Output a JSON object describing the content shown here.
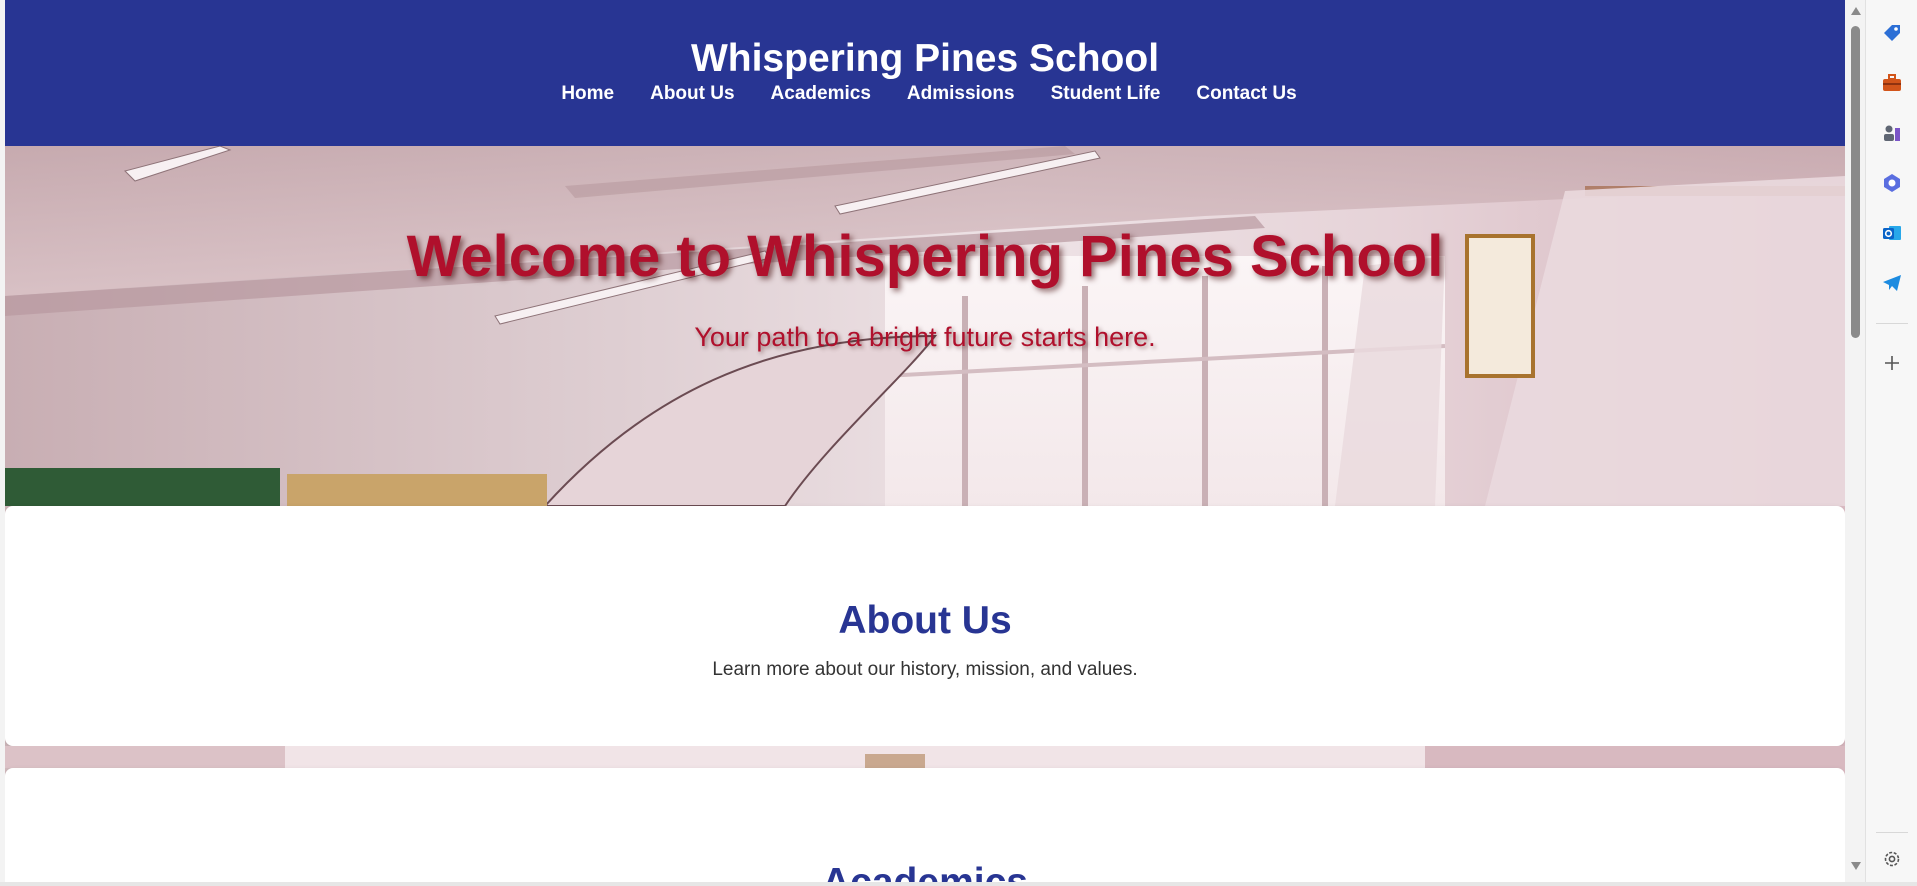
{
  "header": {
    "title": "Whispering Pines School",
    "nav": [
      {
        "label": "Home"
      },
      {
        "label": "About Us"
      },
      {
        "label": "Academics"
      },
      {
        "label": "Admissions"
      },
      {
        "label": "Student Life"
      },
      {
        "label": "Contact Us"
      }
    ]
  },
  "hero": {
    "title": "Welcome to Whispering Pines School",
    "subtitle": "Your path to a bright future starts here."
  },
  "sections": [
    {
      "title": "About Us",
      "text": "Learn more about our history, mission, and values."
    },
    {
      "title": "Academics"
    }
  ],
  "sidebar": {
    "icons": [
      "tag-icon",
      "toolbox-icon",
      "chess-icon",
      "copilot-icon",
      "outlook-icon",
      "telegram-icon",
      "add-icon",
      "settings-icon"
    ]
  },
  "colors": {
    "header_bg": "#283593",
    "hero_text": "#b0102c",
    "section_title": "#283593"
  }
}
